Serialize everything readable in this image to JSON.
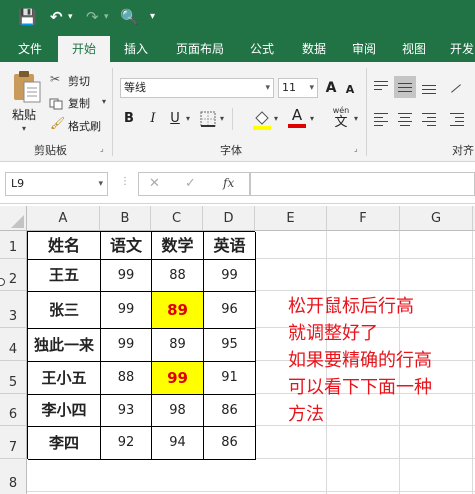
{
  "qat": {
    "save": "💾",
    "undo": "↶",
    "redo": "↷",
    "preview": "🔍",
    "more": "▾"
  },
  "tabs": [
    "文件",
    "开始",
    "插入",
    "页面布局",
    "公式",
    "数据",
    "审阅",
    "视图",
    "开发"
  ],
  "active_tab": "开始",
  "clipboard": {
    "paste": "粘贴",
    "cut": "剪切",
    "copy": "复制",
    "format_painter": "格式刷",
    "group": "剪贴板"
  },
  "font": {
    "name": "等线",
    "size": "11",
    "bold": "B",
    "italic": "I",
    "underline": "U",
    "group": "字体",
    "grow": "A",
    "shrink": "A",
    "wen": "wén",
    "wen_char": "文"
  },
  "alignment": {
    "group": "对齐"
  },
  "formula_bar": {
    "name_box": "L9",
    "cancel": "✕",
    "enter": "✓",
    "fx": "fx",
    "value": ""
  },
  "sheet": {
    "columns": [
      "A",
      "B",
      "C",
      "D",
      "E",
      "F",
      "G"
    ],
    "rows": [
      "1",
      "2",
      "3",
      "4",
      "5",
      "6",
      "7",
      "8"
    ],
    "header_row": [
      "姓名",
      "语文",
      "数学",
      "英语"
    ],
    "data": [
      [
        "王五",
        "99",
        "88",
        "99"
      ],
      [
        "张三",
        "99",
        "89",
        "96"
      ],
      [
        "独此一来",
        "99",
        "89",
        "95"
      ],
      [
        "王小五",
        "88",
        "99",
        "91"
      ],
      [
        "李小四",
        "93",
        "98",
        "86"
      ],
      [
        "李四",
        "92",
        "94",
        "86"
      ]
    ],
    "highlight_color": "#ffff00",
    "highlight_text_color": "#e00000"
  },
  "note": {
    "lines": [
      "松开鼠标后行高",
      "就调整好了",
      "如果要精确的行高",
      "可以看下下面一种",
      "方法"
    ],
    "color": "#e8131b"
  }
}
